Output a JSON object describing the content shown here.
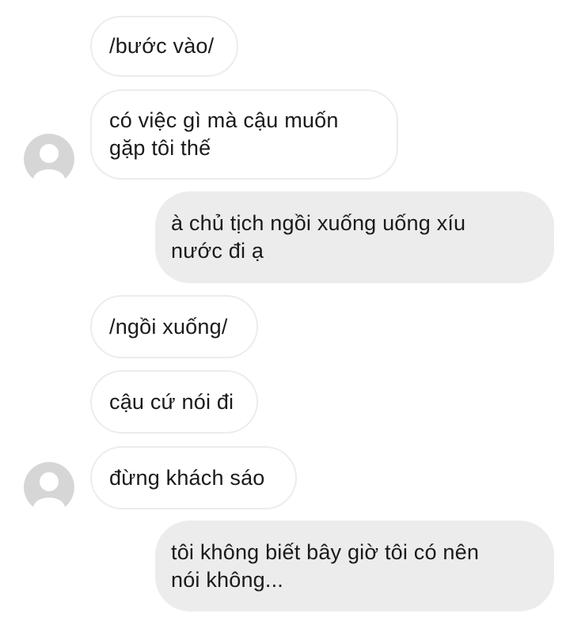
{
  "conversation": {
    "messages": [
      {
        "id": "m1",
        "direction": "incoming",
        "text": "/bước vào/"
      },
      {
        "id": "m2",
        "direction": "incoming",
        "text": "có việc gì mà cậu muốn\ngặp tôi thế"
      },
      {
        "id": "m3",
        "direction": "outgoing",
        "text": "à chủ tịch ngồi xuống uống xíu\nnước đi ạ"
      },
      {
        "id": "m4",
        "direction": "incoming",
        "text": "/ngồi xuống/"
      },
      {
        "id": "m5",
        "direction": "incoming",
        "text": "cậu cứ nói đi"
      },
      {
        "id": "m6",
        "direction": "incoming",
        "text": "đừng khách sáo"
      },
      {
        "id": "m7",
        "direction": "outgoing",
        "text": "tôi không biết bây giờ tôi có nên\nnói không..."
      }
    ]
  },
  "colors": {
    "incoming_bubble_bg": "#ffffff",
    "incoming_bubble_border": "#ececec",
    "outgoing_bubble_bg": "#ececec",
    "text": "#1a1a1a",
    "avatar_bg": "#d6d6d6",
    "avatar_figure": "#ffffff"
  },
  "icons": {
    "avatar": "default-user-avatar-icon"
  }
}
